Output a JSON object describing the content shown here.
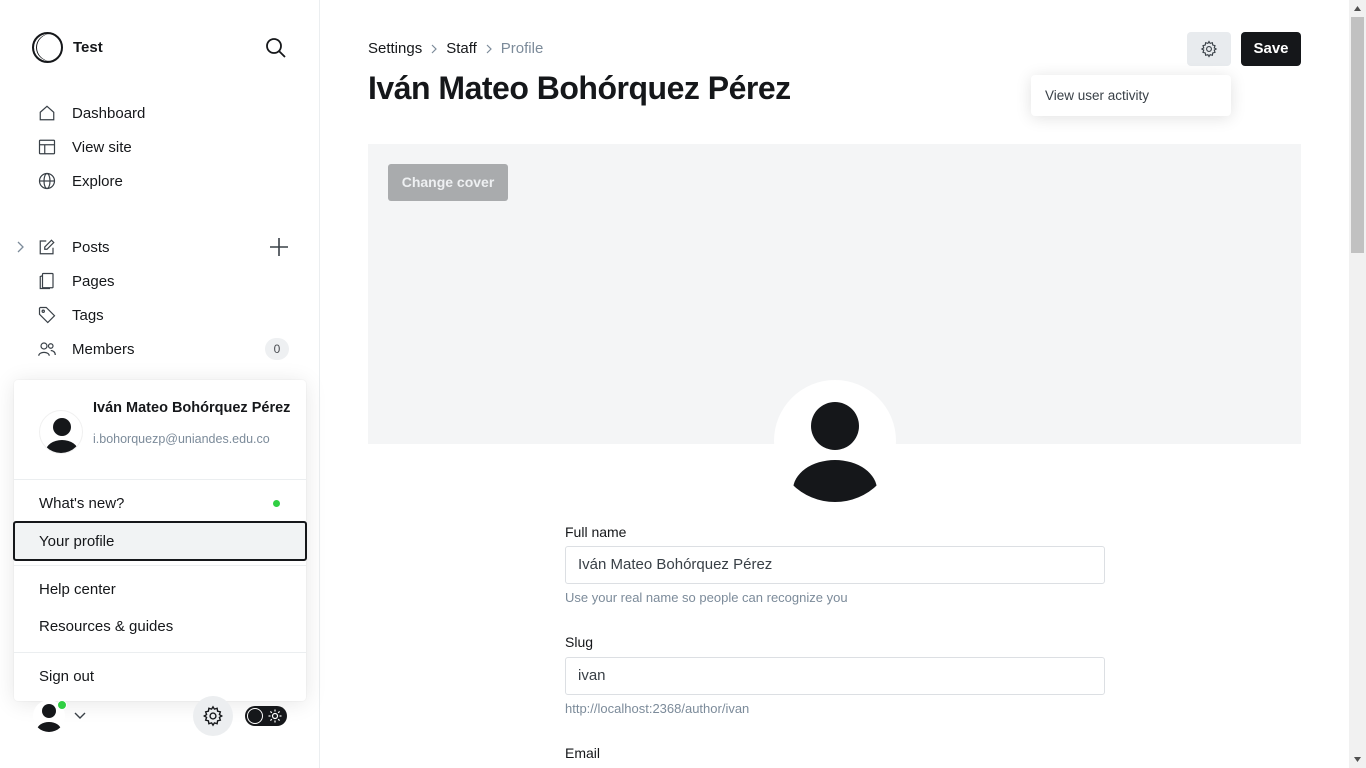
{
  "site": {
    "title": "Test"
  },
  "nav": {
    "dashboard": "Dashboard",
    "view_site": "View site",
    "explore": "Explore",
    "posts": "Posts",
    "pages": "Pages",
    "tags": "Tags",
    "members": "Members",
    "members_count": "0"
  },
  "user_menu": {
    "name": "Iván Mateo Bohórquez Pérez",
    "email": "i.bohorquezp@uniandes.edu.co",
    "whats_new": "What's new?",
    "your_profile": "Your profile",
    "help_center": "Help center",
    "resources": "Resources & guides",
    "sign_out": "Sign out"
  },
  "breadcrumb": {
    "settings": "Settings",
    "staff": "Staff",
    "profile": "Profile"
  },
  "page_title": "Iván Mateo Bohórquez Pérez",
  "actions": {
    "save": "Save",
    "dropdown_item": "View user activity"
  },
  "cover": {
    "change_cover": "Change cover"
  },
  "form": {
    "full_name_label": "Full name",
    "full_name_value": "Iván Mateo Bohórquez Pérez",
    "full_name_hint": "Use your real name so people can recognize you",
    "slug_label": "Slug",
    "slug_value": "ivan",
    "slug_hint": "http://localhost:2368/author/ivan",
    "email_label": "Email"
  },
  "colors": {
    "accent_dark": "#15171a",
    "online": "#30cf43",
    "muted": "#7c8b9a"
  }
}
